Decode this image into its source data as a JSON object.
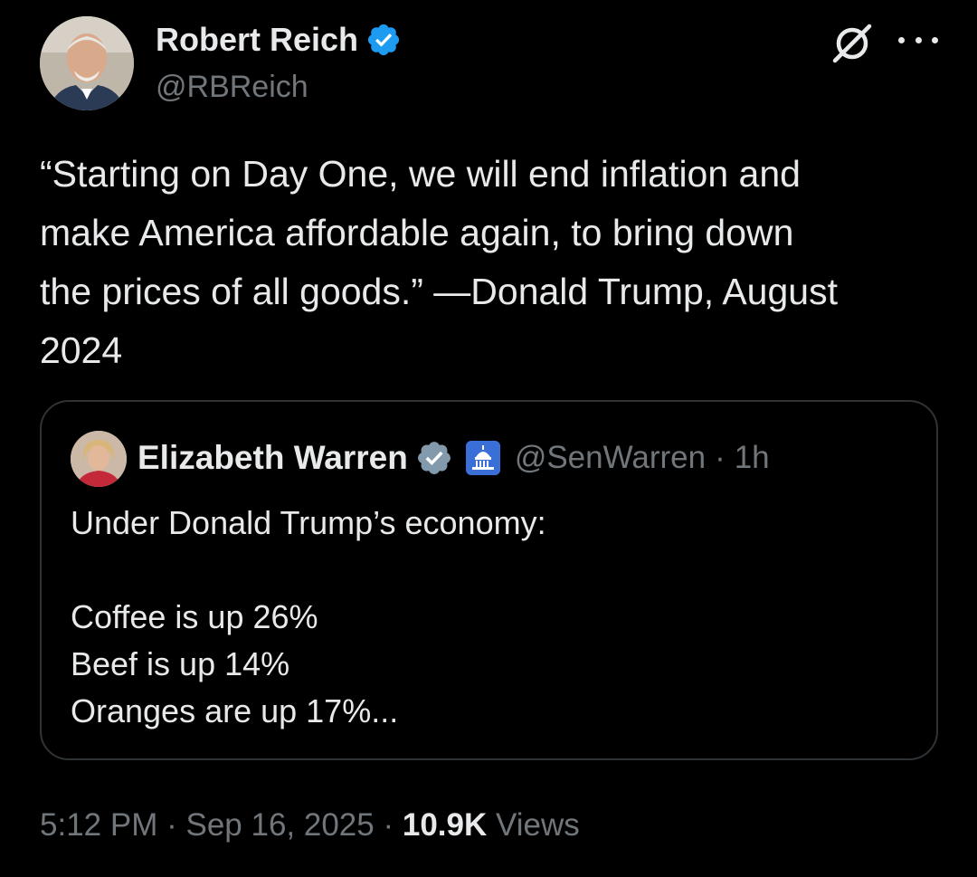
{
  "author": {
    "display_name": "Robert Reich",
    "handle": "@RBReich",
    "verified_color": "#1d9bf0"
  },
  "post": {
    "text": "“Starting on Day One, we will end inflation and\nmake America affordable again, to bring down\nthe prices of all goods.” —Donald Trump, August\n2024"
  },
  "quote": {
    "display_name": "Elizabeth Warren",
    "handle": "@SenWarren",
    "separator": "·",
    "time_ago": "1h",
    "verified_color": "#829aab",
    "government_badge_icon": "capitol-icon",
    "text": "Under Donald Trump’s economy:\n\nCoffee is up 26%\nBeef is up 14%\nOranges are up 17%..."
  },
  "meta": {
    "time": "5:12 PM",
    "separator": "·",
    "date": "Sep 16, 2025",
    "views_count": "10.9K",
    "views_label": "Views"
  },
  "icons": {
    "grok": "grok-icon",
    "more": "more-icon"
  }
}
